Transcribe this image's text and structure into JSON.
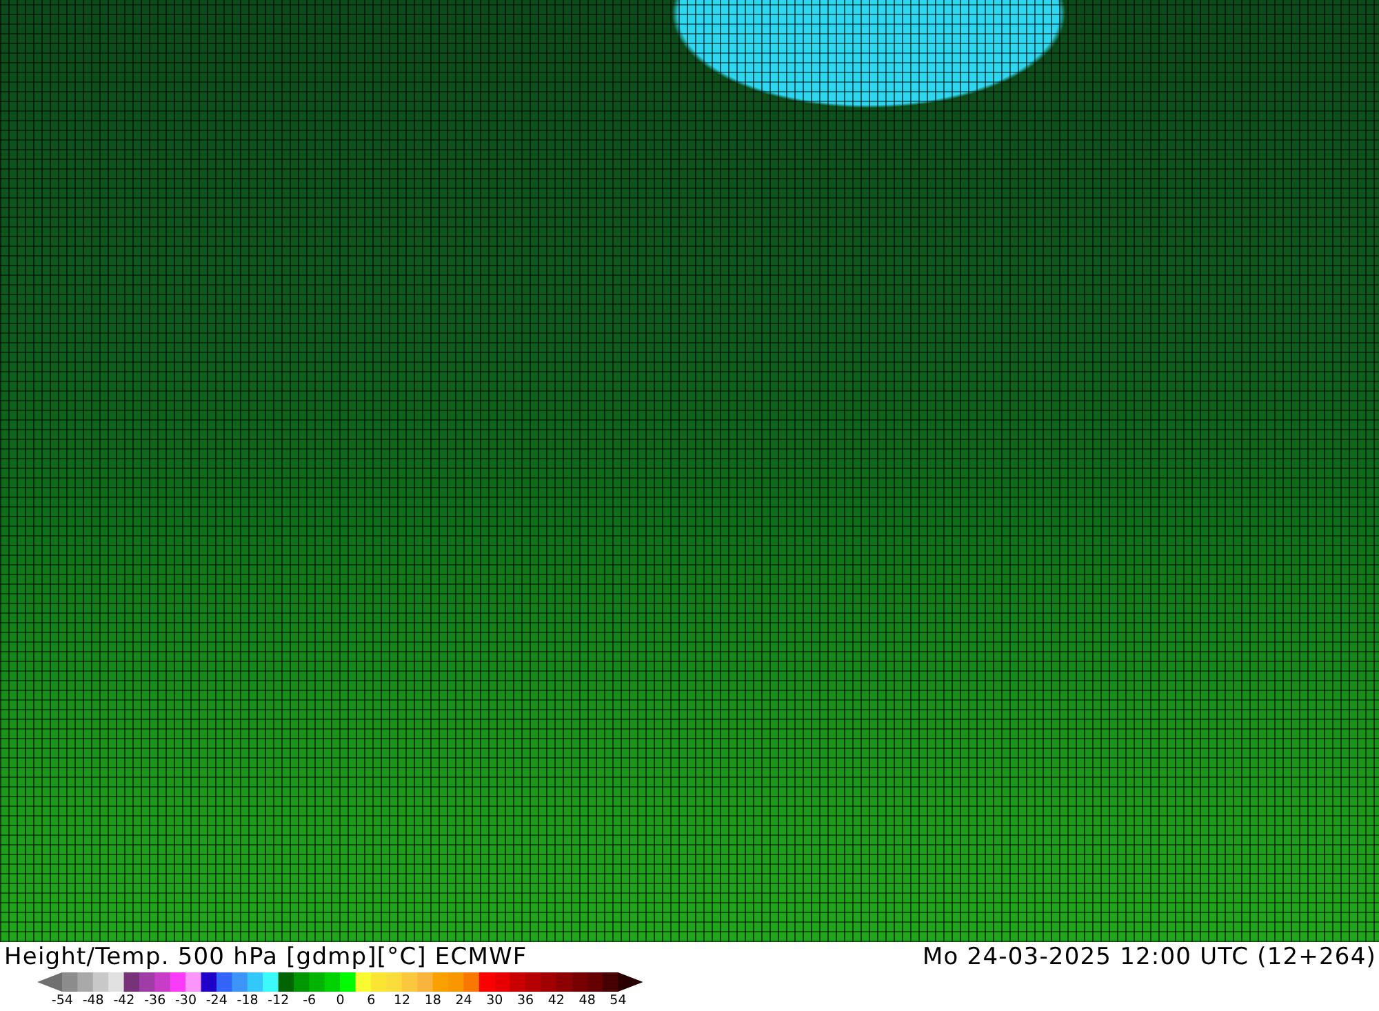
{
  "map": {
    "title": "Height/Temp. 500 hPa [gdmp][°C] ECMWF",
    "valid_time": "Mo 24-03-2025 12:00 UTC (12+264)"
  },
  "legend": {
    "ticks": [
      "-54",
      "-48",
      "-42",
      "-36",
      "-30",
      "-24",
      "-18",
      "-12",
      "-6",
      "0",
      "6",
      "12",
      "18",
      "24",
      "30",
      "36",
      "42",
      "48",
      "54"
    ]
  }
}
